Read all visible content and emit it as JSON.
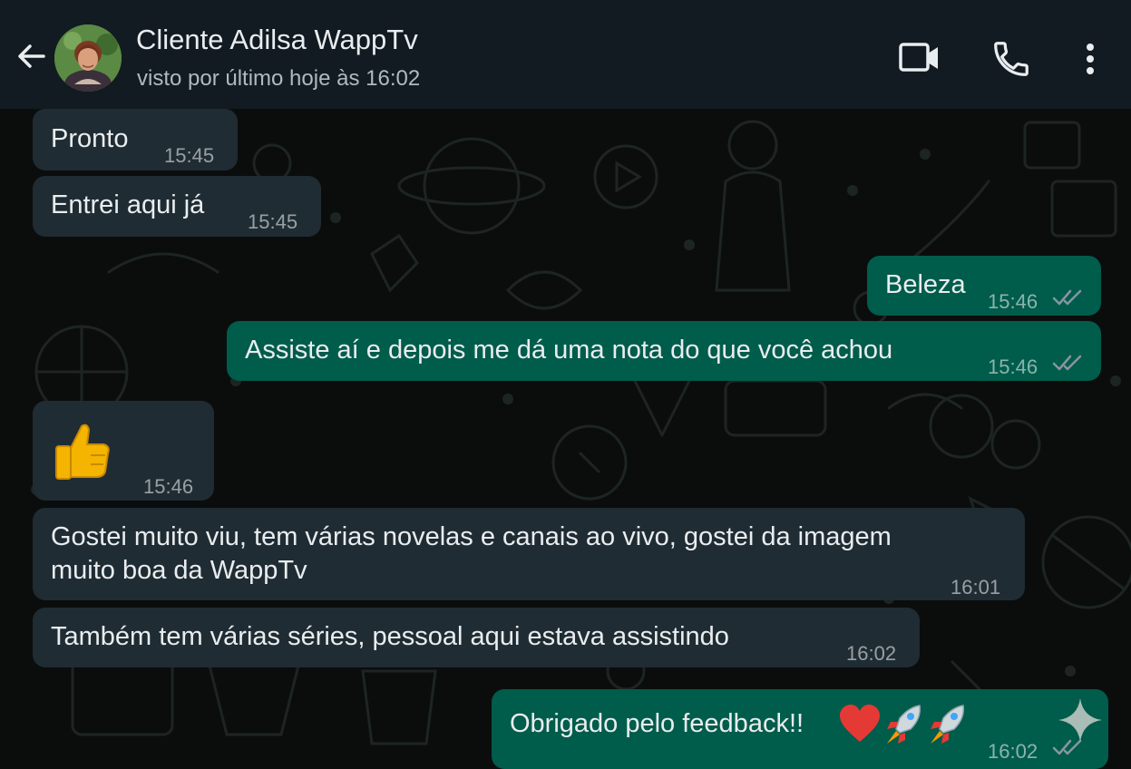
{
  "header": {
    "contact_name": "Cliente Adilsa WappTv",
    "last_seen": "visto por último hoje às 16:02",
    "icons": [
      "back-arrow-icon",
      "avatar",
      "video-call-icon",
      "phone-icon",
      "more-vert-icon"
    ]
  },
  "messages": [
    {
      "direction": "in",
      "text": "Pronto",
      "time": "15:45"
    },
    {
      "direction": "in",
      "text": "Entrei aqui já",
      "time": "15:45"
    },
    {
      "direction": "out",
      "text": "Beleza",
      "time": "15:46",
      "status": "read"
    },
    {
      "direction": "out",
      "text": "Assiste aí e depois me dá uma nota do que você achou",
      "time": "15:46",
      "status": "read"
    },
    {
      "direction": "in",
      "emoji": "thumbs-up",
      "time": "15:46"
    },
    {
      "direction": "in",
      "line1": "Gostei muito viu, tem várias novelas e canais ao vivo, gostei da imagem",
      "line2": "muito boa da WappTv",
      "time": "16:01"
    },
    {
      "direction": "in",
      "text": "Também tem várias séries, pessoal aqui estava assistindo",
      "time": "16:02"
    },
    {
      "direction": "out",
      "text": "Obrigado pelo feedback!!",
      "emojis": [
        "red-heart",
        "rocket",
        "rocket"
      ],
      "time": "16:02",
      "status": "read"
    }
  ],
  "colors": {
    "header_bg": "#111b21",
    "chat_bg": "#0b0d0c",
    "incoming_bubble": "#202c33",
    "outgoing_bubble": "#005c4b",
    "read_ticks": "#8696a0"
  }
}
